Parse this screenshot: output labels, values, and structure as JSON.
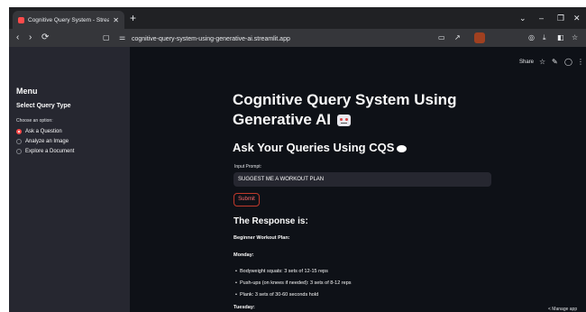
{
  "browser": {
    "tab_title": "Cognitive Query System - Stream",
    "tab_close": "✕",
    "new_tab": "+",
    "window_controls": [
      "⌄",
      "–",
      "❐",
      "✕"
    ],
    "nav": {
      "back": "‹",
      "forward": "›",
      "reload": "⟳"
    },
    "url": "cognitive-query-system-using-generative-ai.streamlit.app",
    "toolbar_icons": [
      "download-icon",
      "sidebar-icon",
      "bookmark-icon",
      "menu-icon"
    ]
  },
  "app": {
    "top_actions": {
      "share": "Share",
      "star": "☆",
      "edit": "✎",
      "github": "◯",
      "more": "⋮"
    },
    "sidebar": {
      "menu": "Menu",
      "section": "Select Query Type",
      "choose_label": "Choose an option:",
      "options": [
        {
          "label": "Ask a Question",
          "selected": true
        },
        {
          "label": "Analyze an Image",
          "selected": false
        },
        {
          "label": "Explore a Document",
          "selected": false
        }
      ]
    },
    "main": {
      "title": "Cognitive Query System Using Generative AI",
      "subtitle": "Ask Your Queries Using CQS",
      "input_label": "Input Prompt:",
      "input_value": "SUGGEST ME A WORKOUT PLAN",
      "submit": "Submit",
      "response_heading": "The Response is:",
      "plan_title": "Beginner Workout Plan:",
      "monday": "Monday:",
      "items": [
        "Bodyweight squats: 3 sets of 12-15 reps",
        "Push-ups (on knees if needed): 3 sets of 8-12 reps",
        "Plank: 3 sets of 30-60 seconds hold"
      ],
      "tuesday": "Tuesday:"
    },
    "manage": "< Manage app"
  }
}
